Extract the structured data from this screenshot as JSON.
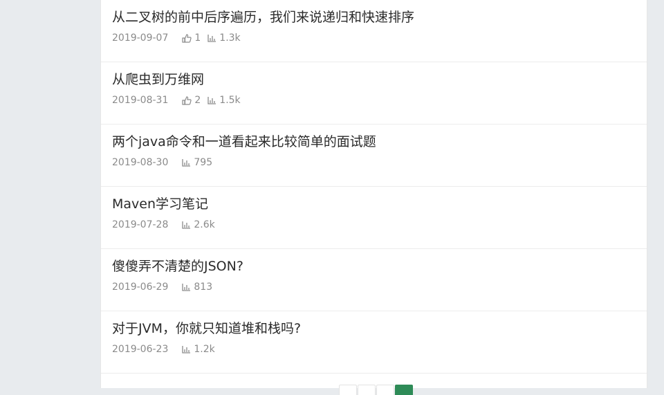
{
  "articles": [
    {
      "title": "从二叉树的前中后序遍历，我们来说递归和快速排序",
      "date": "2019-09-07",
      "likes": "1",
      "views": "1.3k"
    },
    {
      "title": "从爬虫到万维网",
      "date": "2019-08-31",
      "likes": "2",
      "views": "1.5k"
    },
    {
      "title": "两个java命令和一道看起来比较简单的面试题",
      "date": "2019-08-30",
      "likes": null,
      "views": "795"
    },
    {
      "title": "Maven学习笔记",
      "date": "2019-07-28",
      "likes": null,
      "views": "2.6k"
    },
    {
      "title": "傻傻弄不清楚的JSON?",
      "date": "2019-06-29",
      "likes": null,
      "views": "813"
    },
    {
      "title": "对于JVM，你就只知道堆和栈吗?",
      "date": "2019-06-23",
      "likes": null,
      "views": "1.2k"
    }
  ],
  "icons": {
    "like": "thumbs-up-icon",
    "views": "bar-chart-icon"
  },
  "colors": {
    "page_bg": "#e8ebee",
    "accent": "#2e8b57",
    "meta_text": "#8a8a8a",
    "title_text": "#2a2a2a"
  }
}
